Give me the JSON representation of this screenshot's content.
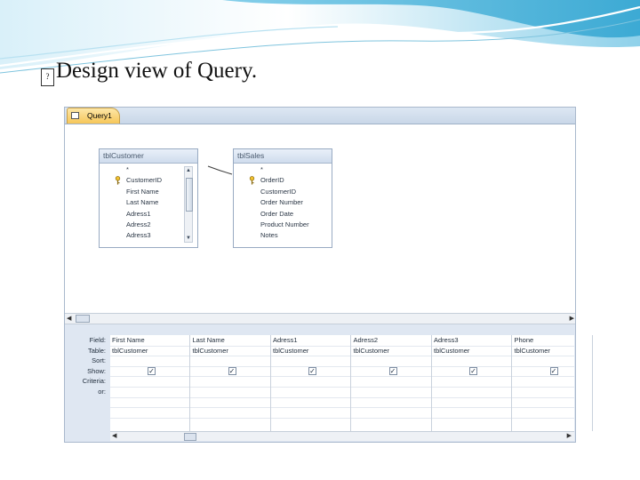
{
  "slide": {
    "title": "Design view of Query.",
    "bullet_glyph": "?"
  },
  "query_tab": {
    "label": "Query1"
  },
  "tables": [
    {
      "name": "tblCustomer",
      "fields": [
        "*",
        "CustomerID",
        "First Name",
        "Last Name",
        "Adress1",
        "Adress2",
        "Adress3"
      ],
      "key_field_index": 1,
      "has_scrollbar": true
    },
    {
      "name": "tblSales",
      "fields": [
        "*",
        "OrderID",
        "CustomerID",
        "Order Number",
        "Order Date",
        "Product Number",
        "Notes"
      ],
      "key_field_index": 1,
      "has_scrollbar": false
    }
  ],
  "grid": {
    "row_labels": [
      "Field:",
      "Table:",
      "Sort:",
      "Show:",
      "Criteria:",
      "or:"
    ],
    "columns": [
      {
        "field": "First Name",
        "table": "tblCustomer",
        "show": true
      },
      {
        "field": "Last Name",
        "table": "tblCustomer",
        "show": true
      },
      {
        "field": "Adress1",
        "table": "tblCustomer",
        "show": true
      },
      {
        "field": "Adress2",
        "table": "tblCustomer",
        "show": true
      },
      {
        "field": "Adress3",
        "table": "tblCustomer",
        "show": true
      },
      {
        "field": "Phone",
        "table": "tblCustomer",
        "show": true
      }
    ]
  },
  "colors": {
    "tab_active": "#f6c659",
    "workspace_bg": "#dfe7f2",
    "table_header_bg": "#cfdced",
    "banner_top": "#4fb3d9"
  },
  "icons": {
    "bullet": "placeholder-glyph-icon",
    "tab": "query-icon",
    "key": "primary-key-icon",
    "checkbox": "checkmark-icon"
  }
}
